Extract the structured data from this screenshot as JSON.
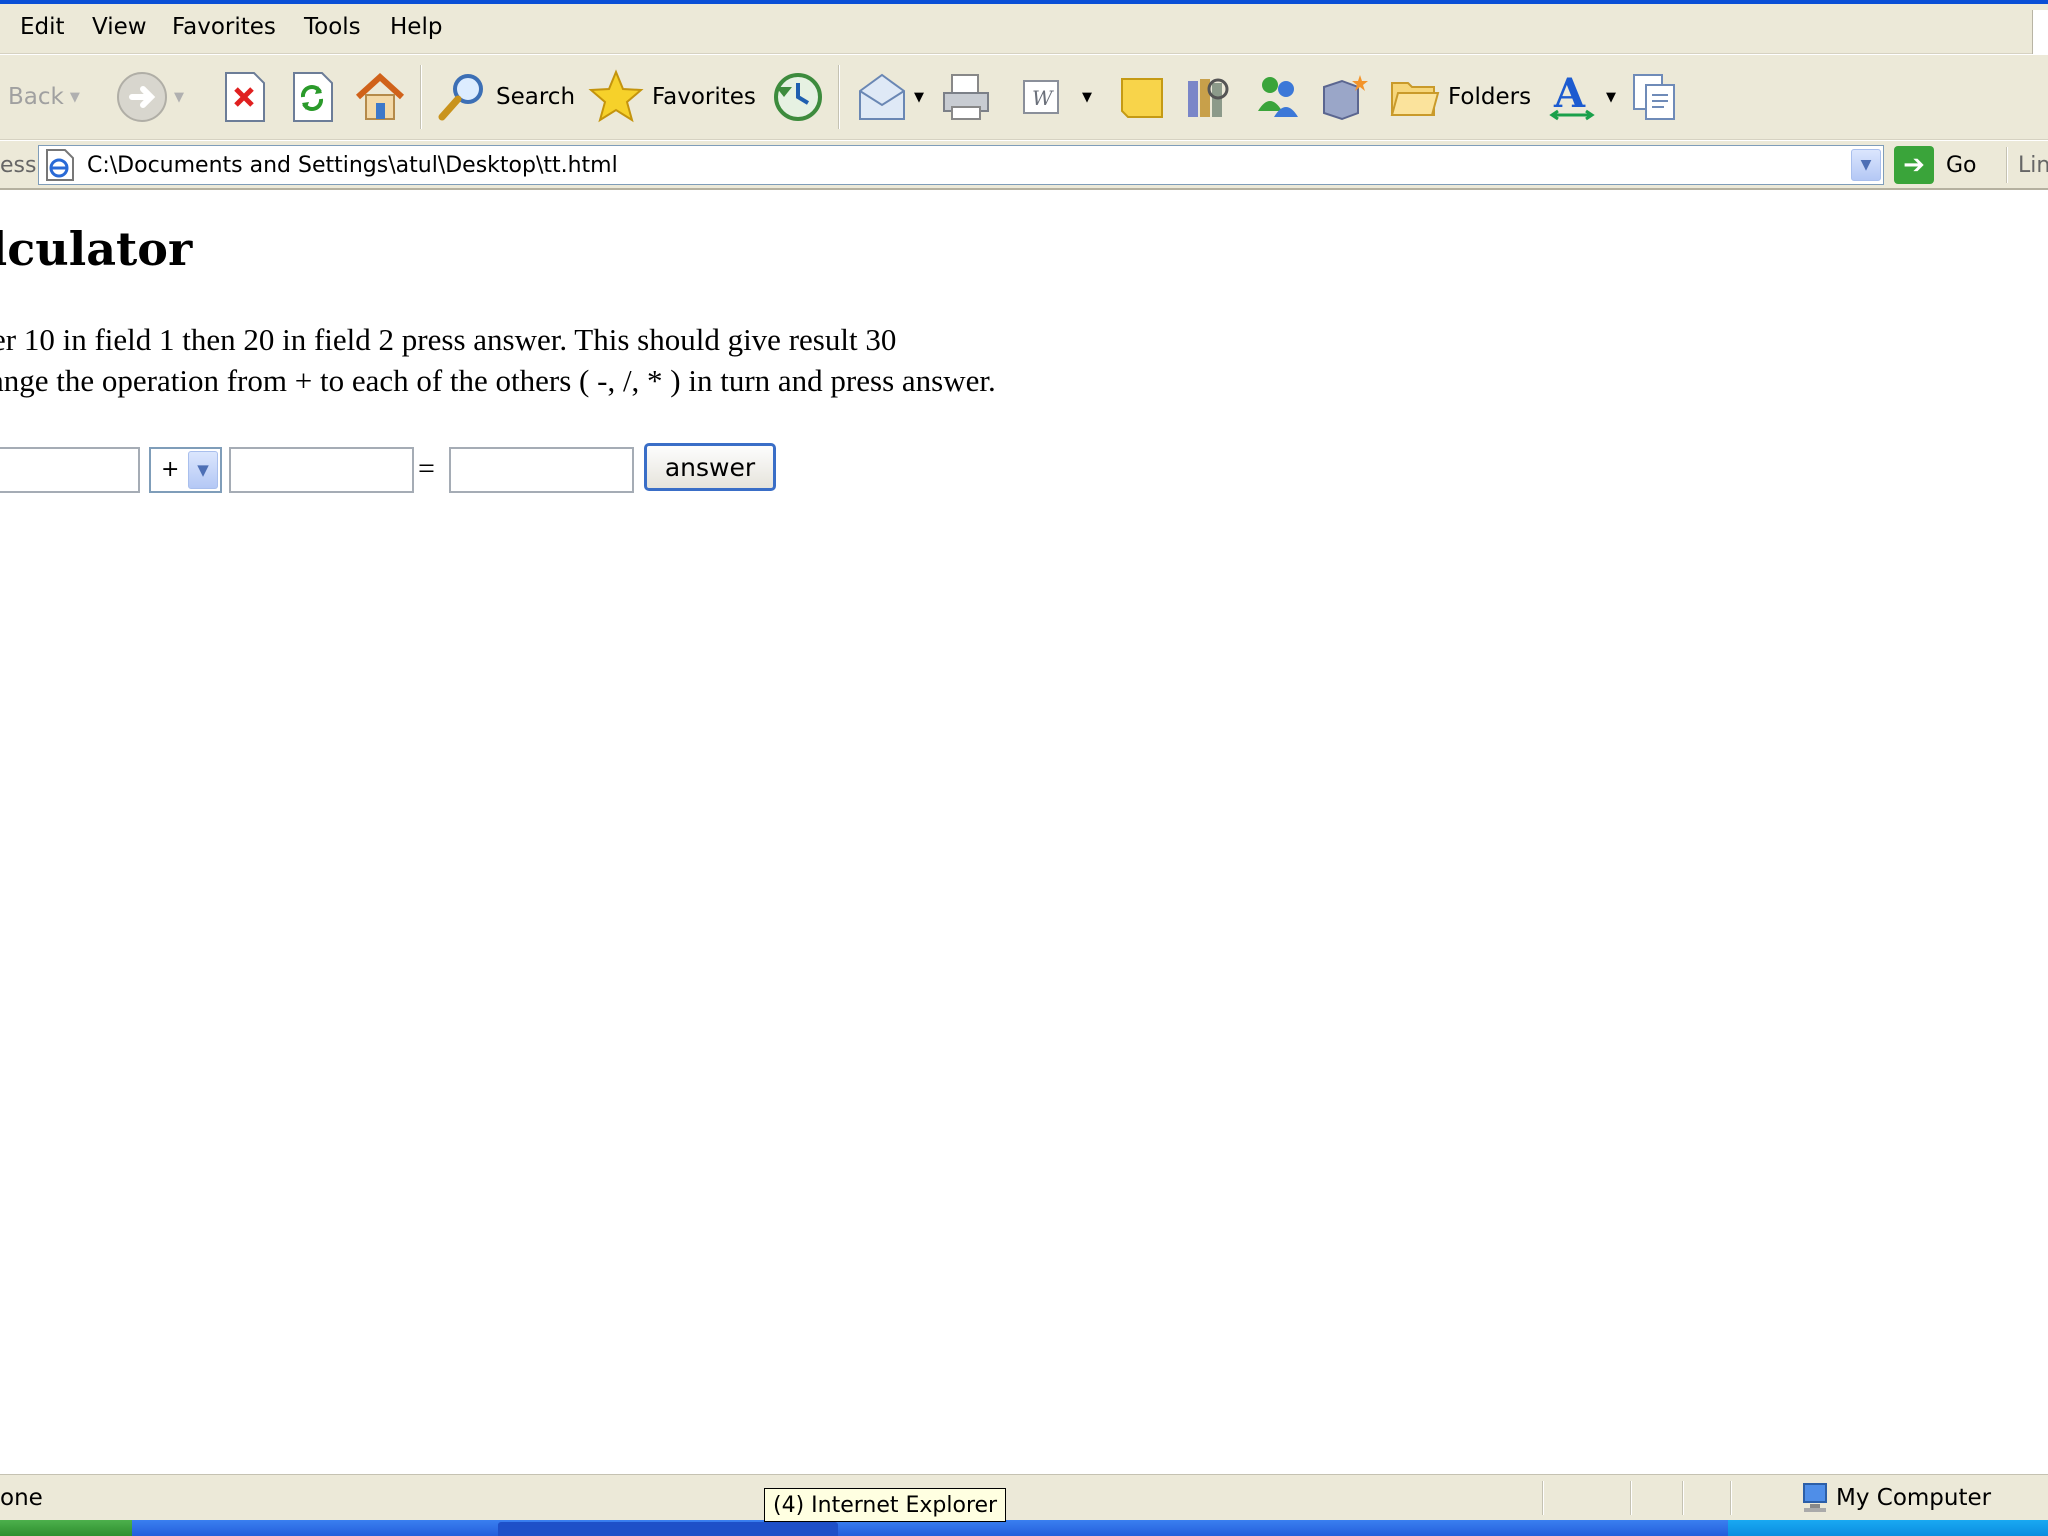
{
  "menubar": {
    "items": [
      "Edit",
      "View",
      "Favorites",
      "Tools",
      "Help"
    ]
  },
  "toolbar": {
    "back_label": "Back",
    "search_label": "Search",
    "favorites_label": "Favorites",
    "folders_label": "Folders",
    "icons": [
      "back-icon",
      "forward-icon",
      "stop-icon",
      "refresh-icon",
      "home-icon",
      "search-icon",
      "favorites-star-icon",
      "history-icon",
      "mail-icon",
      "print-icon",
      "edit-word-icon",
      "discuss-icon",
      "research-icon",
      "messenger-icon",
      "software-icon",
      "folders-icon",
      "font-size-icon",
      "copy-pages-icon"
    ]
  },
  "address": {
    "label": "ess",
    "url": "C:\\Documents and Settings\\atul\\Desktop\\tt.html",
    "go_label": "Go",
    "links_label": "Lin"
  },
  "page": {
    "heading": "alculator",
    "instruction_1": "er 10 in field 1 then 20 in field 2 press answer. This should give result 30",
    "instruction_2": "ange the operation from + to each of the others ( -, /, * ) in turn and press answer.",
    "field1_value": "",
    "operator_selected": "+",
    "field2_value": "",
    "equals_sign": "=",
    "result_value": "",
    "answer_button_label": "answer"
  },
  "statusbar": {
    "status_text": "one",
    "zone_label": "My Computer",
    "tooltip": "(4) Internet Explorer"
  },
  "colors": {
    "chrome": "#ece9d8",
    "titlebar_blue": "#0a4fd6",
    "taskbar_blue": "#245edb",
    "start_green": "#3aa43a"
  }
}
